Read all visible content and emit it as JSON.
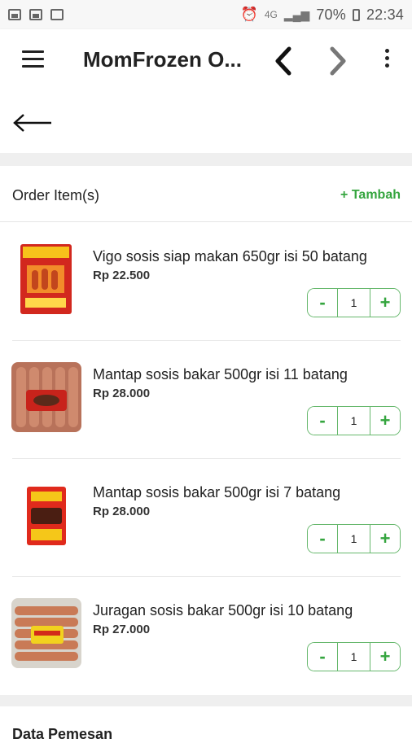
{
  "status_bar": {
    "network": "4G",
    "battery": "70%",
    "time": "22:34"
  },
  "app_bar": {
    "title": "MomFrozen O...",
    "icons": [
      "menu-icon",
      "chevron-left-icon",
      "chevron-right-icon",
      "more-vert-icon"
    ]
  },
  "orders": {
    "title": "Order Item(s)",
    "add_label": "+ Tambah",
    "items": [
      {
        "name": "Vigo sosis siap makan 650gr isi 50 batang",
        "price": "Rp 22.500",
        "qty": "1",
        "minus": "-",
        "plus": "+"
      },
      {
        "name": "Mantap sosis bakar 500gr isi 11 batang",
        "price": "Rp 28.000",
        "qty": "1",
        "minus": "-",
        "plus": "+"
      },
      {
        "name": "Mantap sosis bakar 500gr isi 7 batang",
        "price": "Rp 28.000",
        "qty": "1",
        "minus": "-",
        "plus": "+"
      },
      {
        "name": "Juragan sosis bakar 500gr isi 10 batang",
        "price": "Rp 27.000",
        "qty": "1",
        "minus": "-",
        "plus": "+"
      }
    ]
  },
  "data_section": {
    "title": "Data Pemesan"
  },
  "colors": {
    "accent_green": "#35a53f",
    "stepper_border": "#67b86d",
    "divider": "#efefef"
  }
}
